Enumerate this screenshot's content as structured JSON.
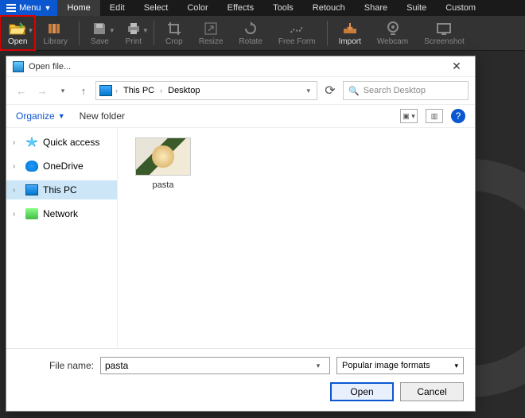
{
  "menu": {
    "button": "Menu"
  },
  "tabs": [
    "Home",
    "Edit",
    "Select",
    "Color",
    "Effects",
    "Tools",
    "Retouch",
    "Share",
    "Suite",
    "Custom"
  ],
  "active_tab": 0,
  "ribbon": [
    {
      "id": "open",
      "label": "Open",
      "hl": true,
      "has_drop": true
    },
    {
      "id": "library",
      "label": "Library"
    },
    {
      "id": "save",
      "label": "Save",
      "has_drop": true
    },
    {
      "id": "print",
      "label": "Print",
      "has_drop": true
    },
    {
      "id": "crop",
      "label": "Crop"
    },
    {
      "id": "resize",
      "label": "Resize"
    },
    {
      "id": "rotate",
      "label": "Rotate"
    },
    {
      "id": "freeform",
      "label": "Free Form"
    },
    {
      "id": "import",
      "label": "Import"
    },
    {
      "id": "webcam",
      "label": "Webcam"
    },
    {
      "id": "screenshot",
      "label": "Screenshot"
    }
  ],
  "dialog": {
    "title": "Open file...",
    "breadcrumb": [
      "This PC",
      "Desktop"
    ],
    "search_placeholder": "Search Desktop",
    "organize": "Organize",
    "new_folder": "New folder",
    "tree": [
      {
        "label": "Quick access",
        "icon": "star"
      },
      {
        "label": "OneDrive",
        "icon": "cloud"
      },
      {
        "label": "This PC",
        "icon": "pc",
        "selected": true
      },
      {
        "label": "Network",
        "icon": "net"
      }
    ],
    "file": {
      "name": "pasta"
    },
    "filename_label": "File name:",
    "filename_value": "pasta",
    "filter": "Popular image formats",
    "open_btn": "Open",
    "cancel_btn": "Cancel",
    "help": "?"
  }
}
